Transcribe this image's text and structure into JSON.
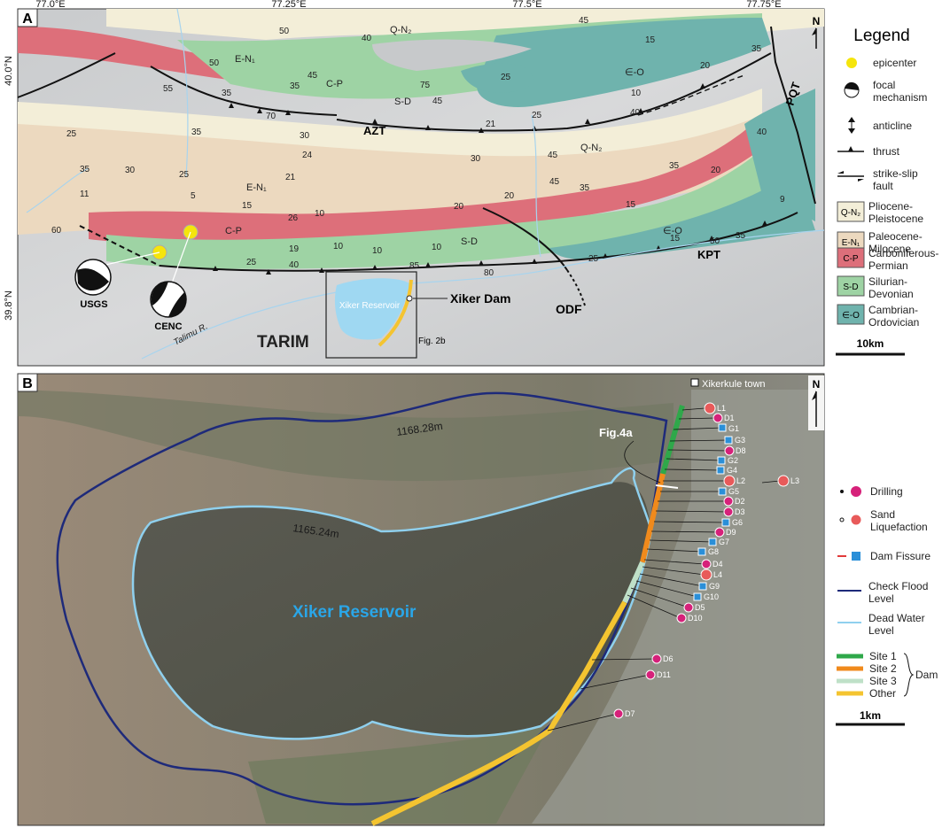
{
  "panel_a": {
    "label": "A",
    "lon_ticks": [
      "77.0°E",
      "77.25°E",
      "77.5°E",
      "77.75°E"
    ],
    "lat_ticks": [
      "40.0°N",
      "39.8°N"
    ],
    "north_label": "N",
    "place_labels": {
      "tarim": "TARIM",
      "talimu": "Talimu R.",
      "reservoir": "Xiker Reservoir",
      "dam": "Xiker Dam",
      "fig2b": "Fig. 2b"
    },
    "fault_labels": {
      "azt": "AZT",
      "kpt": "KPT",
      "odf": "ODF",
      "pqt": "PQT"
    },
    "quake_labels": {
      "usgs": "USGS",
      "cenc": "CENC"
    },
    "formation_labels": [
      "Q-N₂",
      "E-N₁",
      "C-P",
      "S-D",
      "∈-O",
      "Q-N₂",
      "E-N₁",
      "C-P",
      "S-D",
      "∈-O"
    ],
    "dips": [
      "50",
      "40",
      "45",
      "15",
      "35",
      "20",
      "50",
      "45",
      "55",
      "35",
      "35",
      "25",
      "75",
      "45",
      "10",
      "70",
      "21",
      "25",
      "40",
      "25",
      "35",
      "30",
      "24",
      "30",
      "40",
      "35",
      "30",
      "25",
      "21",
      "20",
      "45",
      "35",
      "11",
      "5",
      "15",
      "45",
      "35",
      "26",
      "10",
      "20",
      "20",
      "15",
      "9",
      "19",
      "10",
      "10",
      "10",
      "15",
      "50",
      "35",
      "25",
      "40",
      "85",
      "80",
      "25",
      "60"
    ],
    "legend": {
      "title": "Legend",
      "items": {
        "epicenter": "epicenter",
        "focal_1": "focal",
        "focal_2": "mechanism",
        "anticline": "anticline",
        "thrust": "thrust",
        "ss_1": "strike-slip",
        "ss_2": "fault"
      },
      "units": [
        {
          "code": "Q-N₂",
          "name_1": "Pliocene-",
          "name_2": "Pleistocene",
          "color": "#f3eed8"
        },
        {
          "code": "E-N₁",
          "name_1": "Paleocene-",
          "name_2": "Milocene",
          "color": "#ecd9bf"
        },
        {
          "code": "C-P",
          "name_1": "Carboniferous-",
          "name_2": "Permian",
          "color": "#dd6f7a"
        },
        {
          "code": "S-D",
          "name_1": "Silurian-",
          "name_2": "Devonian",
          "color": "#9ed3a4"
        },
        {
          "code": "∈-O",
          "name_1": "Cambrian-",
          "name_2": "Ordovician",
          "color": "#6fb3ad"
        }
      ],
      "scale": "10km"
    }
  },
  "panel_b": {
    "label": "B",
    "town": "Xikerkule town",
    "north_label": "N",
    "reservoir_label": "Xiker Reservoir",
    "contour_check": "1168.28m",
    "contour_dead": "1165.24m",
    "fig4a": "Fig.4a",
    "points": [
      "L1",
      "D1",
      "G1",
      "G3",
      "D8",
      "G2",
      "G4",
      "L2",
      "L3",
      "G5",
      "D2",
      "D3",
      "G6",
      "D9",
      "G7",
      "G8",
      "D4",
      "L4",
      "G9",
      "G10",
      "D5",
      "D10",
      "D6",
      "D11",
      "D7"
    ],
    "legend": {
      "drilling": "Drilling",
      "sand_1": "Sand",
      "sand_2": "Liquefaction",
      "fissure": "Dam Fissure",
      "check_1": "Check Flood",
      "check_2": "Level",
      "dead_1": "Dead Water",
      "dead_2": "Level",
      "site1": "Site 1",
      "site2": "Site 2",
      "site3": "Site 3",
      "other": "Other",
      "dam": "Dam",
      "scale": "1km"
    },
    "colors": {
      "check_flood": "#1e2a7a",
      "dead_water": "#8fd0ee",
      "site1": "#2fa84a",
      "site2": "#f08a1c",
      "site3": "#bfe0c8",
      "other": "#f4c430",
      "drilling": "#d6217a",
      "fissure": "#2a8fd8",
      "sand": "#e85a5a",
      "water_label": "#2aa6e8"
    }
  }
}
